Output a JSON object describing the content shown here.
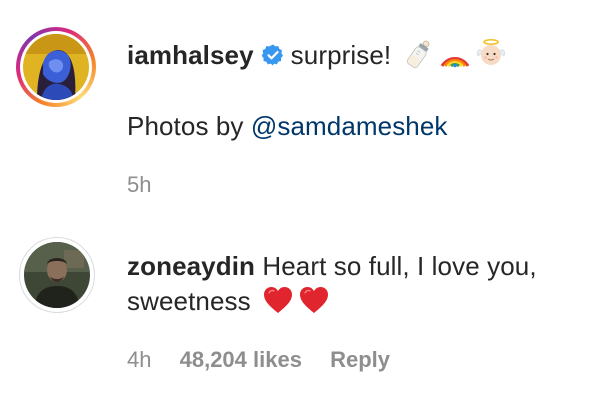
{
  "post": {
    "username": "iamhalsey",
    "verified": true,
    "caption": "surprise!",
    "caption_emojis": [
      "baby-bottle-icon",
      "rainbow-icon",
      "baby-angel-icon"
    ],
    "credit_prefix": "Photos by",
    "credit_mention": "@samdameshek",
    "timestamp": "5h"
  },
  "comment": {
    "username": "zoneaydin",
    "text_line1": "Heart so full, I love you,",
    "text_line2": "sweetness",
    "emojis": [
      "red-heart-icon",
      "red-heart-icon"
    ],
    "timestamp": "4h",
    "likes": "48,204 likes",
    "reply_label": "Reply"
  },
  "colors": {
    "text": "#262626",
    "muted": "#8e8e8e",
    "mention": "#00376b",
    "verified": "#3897f0",
    "heart": "#e0252f"
  }
}
